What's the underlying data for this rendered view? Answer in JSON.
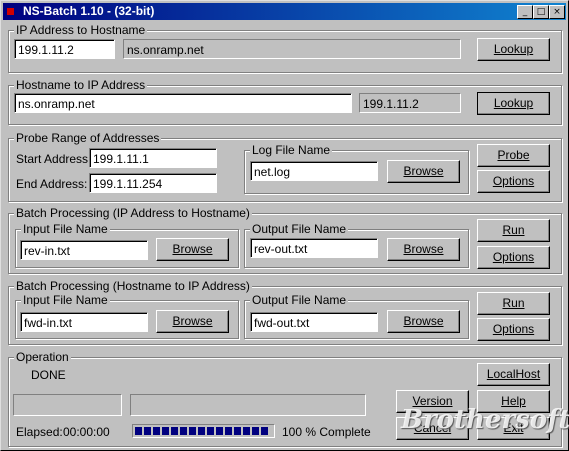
{
  "window": {
    "title": "NS-Batch 1.10  -  (32-bit)",
    "min": "_",
    "max": "□",
    "close": "×"
  },
  "ip_to_host": {
    "label": "IP Address to Hostname",
    "ip": "199.1.11.2",
    "host": "ns.onramp.net",
    "lookup": "Lookup"
  },
  "host_to_ip": {
    "label": "Hostname to IP Address",
    "host": "ns.onramp.net",
    "ip": "199.1.11.2",
    "lookup": "Lookup"
  },
  "probe": {
    "label": "Probe Range of Addresses",
    "start_label": "Start Address:",
    "start": "199.1.11.1",
    "end_label": "End Address:",
    "end": "199.1.11.254",
    "log_label": "Log File Name",
    "log": "net.log",
    "browse": "Browse",
    "probe_btn": "Probe",
    "options": "Options"
  },
  "batch_ip": {
    "label": "Batch Processing  (IP Address to Hostname)",
    "input_label": "Input File Name",
    "input": "rev-in.txt",
    "output_label": "Output File Name",
    "output": "rev-out.txt",
    "browse": "Browse",
    "run": "Run",
    "options": "Options"
  },
  "batch_host": {
    "label": "Batch Processing  (Hostname to IP Address)",
    "input_label": "Input File Name",
    "input": "fwd-in.txt",
    "output_label": "Output File Name",
    "output": "fwd-out.txt",
    "browse": "Browse",
    "run": "Run",
    "options": "Options"
  },
  "operation": {
    "label": "Operation",
    "status": "DONE",
    "elapsed_label": "Elapsed:",
    "elapsed": "00:00:00",
    "progress_text": "100 % Complete",
    "progress": 1.0
  },
  "side_buttons": {
    "localhost": "LocalHost",
    "version": "Version",
    "help": "Help",
    "cancel": "Cancel",
    "exit": "Exit"
  },
  "watermark": "Brothersoft"
}
